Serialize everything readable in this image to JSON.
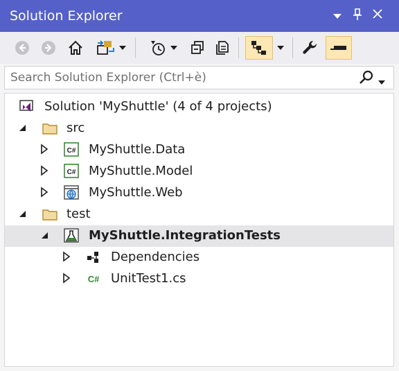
{
  "window": {
    "title": "Solution Explorer",
    "controls": [
      "dropdown-arrow-icon",
      "pin-icon",
      "close-icon"
    ]
  },
  "toolbar": {
    "buttons": [
      {
        "name": "back",
        "icon": "back-arrow-icon",
        "enabled": false
      },
      {
        "name": "forward",
        "icon": "forward-arrow-icon",
        "enabled": false
      },
      {
        "name": "home",
        "icon": "home-icon"
      },
      {
        "name": "switch-views",
        "icon": "switch-views-icon",
        "has_dropdown": true
      },
      {
        "name": "pending-changes-filter",
        "icon": "clock-icon",
        "has_dropdown": true
      },
      {
        "name": "collapse-all",
        "icon": "collapse-all-icon"
      },
      {
        "name": "show-all-files",
        "icon": "copy-files-icon"
      },
      {
        "name": "sync-with-active-document",
        "icon": "tree-view-icon",
        "active": true,
        "has_dropdown": true
      },
      {
        "name": "properties",
        "icon": "wrench-icon"
      },
      {
        "name": "preview-selected-items",
        "icon": "preview-icon",
        "active": true
      }
    ]
  },
  "search": {
    "placeholder": "Search Solution Explorer (Ctrl+è)",
    "icon": "search-icon"
  },
  "tree": {
    "items": [
      {
        "label": "Solution 'MyShuttle' (4 of 4 projects)",
        "icon": "visual-studio-solution-icon",
        "level": 0,
        "expander": "none"
      },
      {
        "label": "src",
        "icon": "folder-icon",
        "level": 1,
        "expander": "expanded"
      },
      {
        "label": "MyShuttle.Data",
        "icon": "csharp-project-icon",
        "level": 2,
        "expander": "collapsed"
      },
      {
        "label": "MyShuttle.Model",
        "icon": "csharp-project-icon",
        "level": 2,
        "expander": "collapsed"
      },
      {
        "label": "MyShuttle.Web",
        "icon": "web-project-icon",
        "level": 2,
        "expander": "collapsed"
      },
      {
        "label": "test",
        "icon": "folder-icon",
        "level": 1,
        "expander": "expanded"
      },
      {
        "label": "MyShuttle.IntegrationTests",
        "icon": "test-project-icon",
        "level": 2,
        "expander": "expanded",
        "selected": true,
        "bold": true
      },
      {
        "label": "Dependencies",
        "icon": "dependencies-icon",
        "level": 3,
        "expander": "collapsed"
      },
      {
        "label": "UnitTest1.cs",
        "icon": "csharp-file-icon",
        "level": 3,
        "expander": "collapsed"
      }
    ]
  },
  "colors": {
    "title_bar": "#5561c8",
    "toolbar_bg": "#eeeef2",
    "active_button_bg": "#fde7b4",
    "selected_row_bg": "#e5e5e8",
    "csharp_green": "#388a34"
  }
}
